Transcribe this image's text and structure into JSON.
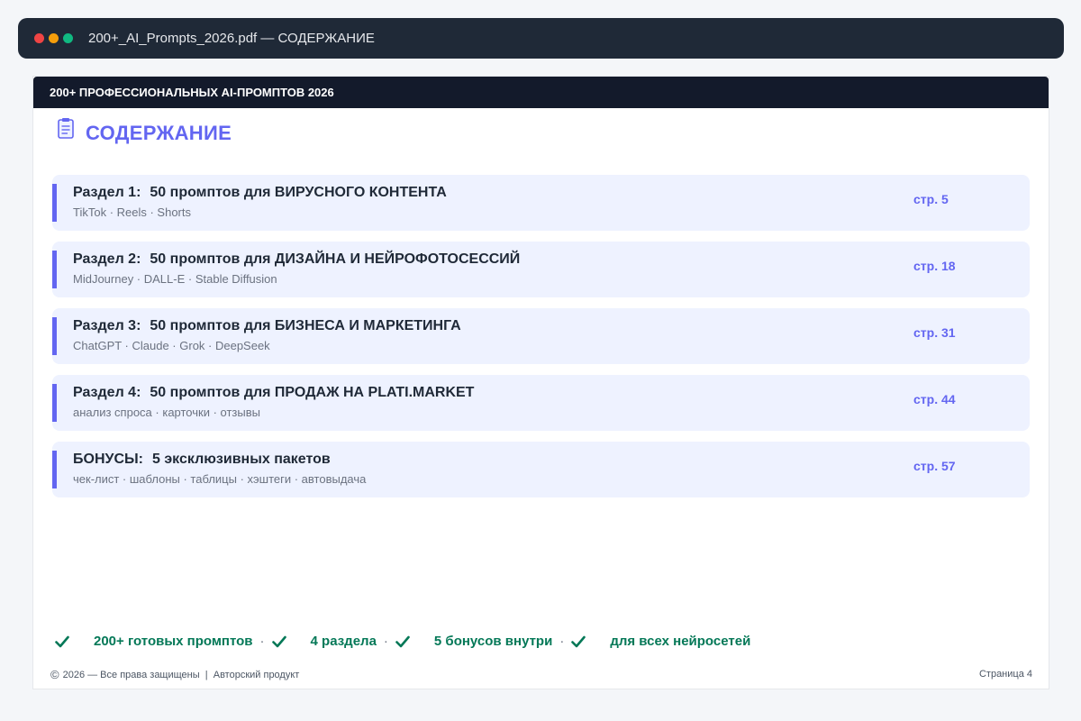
{
  "window": {
    "title": "200+_AI_Prompts_2026.pdf — СОДЕРЖАНИЕ"
  },
  "document": {
    "header": "200+ ПРОФЕССИОНАЛЬНЫХ AI-ПРОМПТОВ 2026",
    "heading": "СОДЕРЖАНИЕ",
    "sections": [
      {
        "label": "Раздел 1:",
        "title": "50 промптов для ВИРУСНОГО КОНТЕНТА",
        "tags": "TikTok · Reels · Shorts",
        "page": "стр. 5"
      },
      {
        "label": "Раздел 2:",
        "title": "50 промптов для ДИЗАЙНА И НЕЙРОФОТОСЕССИЙ",
        "tags": "MidJourney · DALL-E · Stable Diffusion",
        "page": "стр. 18"
      },
      {
        "label": "Раздел 3:",
        "title": "50 промптов для БИЗНЕСА И МАРКЕТИНГА",
        "tags": "ChatGPT · Claude · Grok · DeepSeek",
        "page": "стр. 31"
      },
      {
        "label": "Раздел 4:",
        "title": "50 промптов для ПРОДАЖ НА PLATI.MARKET",
        "tags": "анализ спроса · карточки · отзывы",
        "page": "стр. 44"
      },
      {
        "label": "БОНУСЫ:",
        "title": "5 эксклюзивных пакетов",
        "tags": "чек-лист · шаблоны · таблицы · хэштеги · автовыдача",
        "page": "стр. 57"
      }
    ],
    "features": [
      "200+ готовых промптов",
      "4 раздела",
      "5 бонусов внутри",
      "для всех нейросетей"
    ],
    "feature_separator": "·",
    "footer": {
      "copyright_symbol": "©",
      "left": "2026 — Все права защищены  |  Авторский продукт",
      "right": "Страница 4"
    }
  },
  "colors": {
    "accent": "#6366f1",
    "feature_green": "#047857",
    "titlebar_bg": "#1f2937",
    "doc_header_bg": "#131a2b",
    "item_bg": "#eef2ff"
  }
}
